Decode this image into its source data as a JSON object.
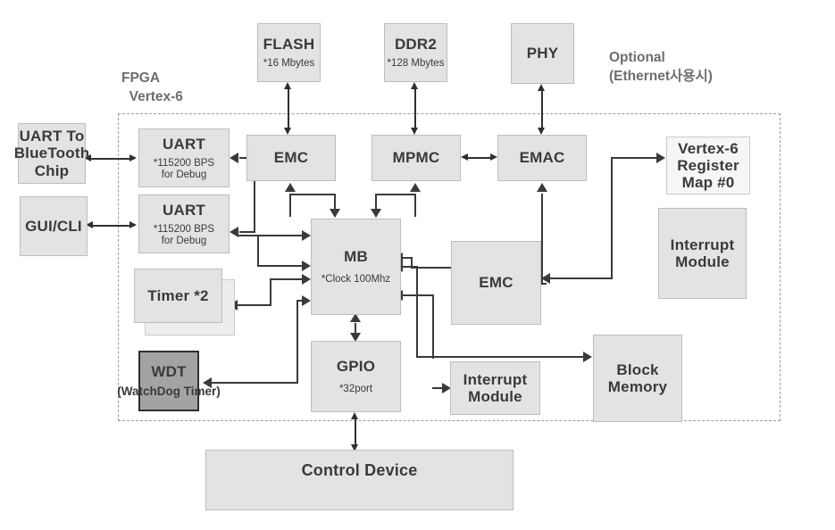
{
  "diagram": {
    "title_label": "FPGA\n  Vertex-6",
    "optional_label": "Optional\n(Ethernet사용시)",
    "fpga_region_name": "FPGA Vertex-6 boundary"
  },
  "blocks": {
    "uart_to_bluetooth": {
      "title": "UART To BlueTooth Chip",
      "sub": ""
    },
    "gui_cli": {
      "title": "GUI/CLI",
      "sub": ""
    },
    "flash": {
      "title": "FLASH",
      "sub": "*16 Mbytes"
    },
    "ddr2": {
      "title": "DDR2",
      "sub": "*128 Mbytes"
    },
    "phy": {
      "title": "PHY",
      "sub": ""
    },
    "uart1": {
      "title": "UART",
      "sub": "*115200 BPS\nfor Debug"
    },
    "uart1_sub_a": "*115200 BPS",
    "uart1_sub_b": "for Debug",
    "uart2": {
      "title": "UART",
      "sub": "*115200 BPS\nfor Debug"
    },
    "uart2_sub_a": "*115200 BPS",
    "uart2_sub_b": "for Debug",
    "timer": {
      "title": "Timer *2",
      "sub": ""
    },
    "wdt": {
      "title": "WDT",
      "sub": "(WatchDog Timer)"
    },
    "emc_top": {
      "title": "EMC",
      "sub": ""
    },
    "mpmc": {
      "title": "MPMC",
      "sub": ""
    },
    "emac": {
      "title": "EMAC",
      "sub": ""
    },
    "mb": {
      "title": "MB",
      "sub": "*Clock 100Mhz"
    },
    "gpio": {
      "title": "GPIO",
      "sub": "*32port"
    },
    "emc_mid": {
      "title": "EMC",
      "sub": ""
    },
    "interrupt_bottom": {
      "title": "Interrupt Module",
      "line1": "Interrupt",
      "line2": "Module"
    },
    "vertex6_regmap": {
      "title": "Vertex-6 Register Map #0",
      "line1": "Vertex-6",
      "line2": "Register",
      "line3": "Map #0"
    },
    "interrupt_right": {
      "title": "Interrupt Module",
      "line1": "Interrupt",
      "line2": "Module"
    },
    "block_memory": {
      "title": "Block Memory",
      "line1": "Block",
      "line2": "Memory"
    },
    "control_device": {
      "title": "Control Device",
      "sub": ""
    }
  },
  "colors": {
    "block_fill": "#e3e3e3",
    "block_border": "#bdbdbd",
    "light_fill": "#f6f6f6",
    "dark_fill": "#a3a3a3",
    "dark_border": "#2f2f2f",
    "line": "#3a3a3a",
    "label_text": "#6d6d6d",
    "body_text": "#3a3a3a",
    "dashed_border": "#9a9a9a",
    "background": "#ffffff"
  }
}
